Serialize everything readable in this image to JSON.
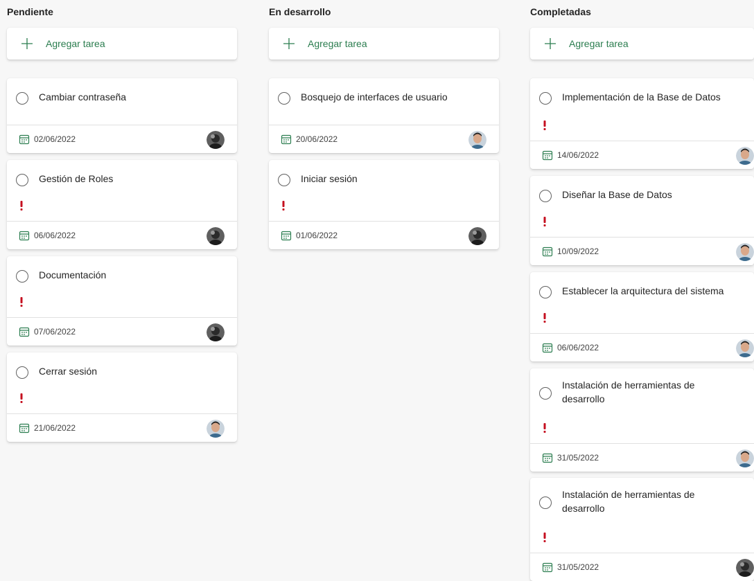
{
  "columns": [
    {
      "title": "Pendiente",
      "add_label": "Agregar tarea",
      "cards": [
        {
          "title": "Cambiar contraseña",
          "date": "02/06/2022",
          "avatar": "avatar-dark",
          "priority": false
        },
        {
          "title": "Gestión de Roles",
          "date": "06/06/2022",
          "avatar": "avatar-dark",
          "priority": true
        },
        {
          "title": "Documentación",
          "date": "07/06/2022",
          "avatar": "avatar-dark",
          "priority": true
        },
        {
          "title": "Cerrar sesión",
          "date": "21/06/2022",
          "avatar": "avatar-light",
          "priority": true
        }
      ]
    },
    {
      "title": "En desarrollo",
      "add_label": "Agregar tarea",
      "cards": [
        {
          "title": "Bosquejo de interfaces de usuario",
          "date": "20/06/2022",
          "avatar": "avatar-light",
          "priority": false
        },
        {
          "title": "Iniciar sesión",
          "date": "01/06/2022",
          "avatar": "avatar-dark",
          "priority": true
        }
      ]
    },
    {
      "title": "Completadas",
      "add_label": "Agregar tarea",
      "cards": [
        {
          "title": "Implementación de la Base de Datos",
          "date": "14/06/2022",
          "avatar": "avatar-light",
          "priority": true
        },
        {
          "title": "Diseñar la Base de Datos",
          "date": "10/09/2022",
          "avatar": "avatar-light",
          "priority": true
        },
        {
          "title": "Establecer la arquitectura del sistema",
          "date": "06/06/2022",
          "avatar": "avatar-light",
          "priority": true
        },
        {
          "title": "Instalación de herramientas de desarrollo",
          "date": "31/05/2022",
          "avatar": "avatar-light",
          "priority": true
        },
        {
          "title": "Instalación de herramientas de desarrollo",
          "date": "31/05/2022",
          "avatar": "avatar-dark",
          "priority": true
        }
      ]
    }
  ],
  "colors": {
    "accent_green": "#2b7d4f",
    "priority_red": "#c50f1f",
    "card_bg": "#ffffff",
    "board_bg": "#f7f7f7"
  },
  "icons": {
    "add": "plus-icon",
    "checkbox": "circle-checkbox-icon",
    "priority": "exclamation-icon",
    "due_date": "calendar-icon"
  }
}
